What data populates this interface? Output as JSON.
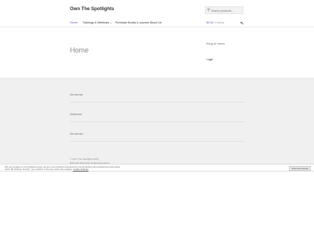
{
  "header": {
    "site_title": "Own The Spotlights",
    "search_placeholder": "Search products...",
    "nav": [
      {
        "label": "Home"
      },
      {
        "label": "Trainings & Webinars"
      },
      {
        "label": "Purchase Books & courses"
      },
      {
        "label": "About Us"
      }
    ],
    "nav_dropdown_marker": "⌄",
    "cart_amount": "$0.00",
    "cart_items": "0 items",
    "cart_icon": "cart-icon"
  },
  "main": {
    "page_title": "Home"
  },
  "sidebar": {
    "heading": "Blog at home",
    "link": "Login"
  },
  "footer": {
    "widgets": [
      "Ad sense",
      "Adsense",
      "Ad sense"
    ],
    "copyright": "© Own The Spotlights 2023",
    "credit_links": "Built with Storefront & WooCommerce."
  },
  "cookie_bar": {
    "text": "We use cookies on our website to give you the most relevant experience by remembering your preferences and repeat visits. By clicking “Accept”, you consent to the use of ALL the cookies.",
    "policy_link": "Cookie Settings",
    "button": "Close and accept"
  },
  "colors": {
    "accent": "#7f54b3",
    "footer_bg": "#f0f0f0"
  }
}
